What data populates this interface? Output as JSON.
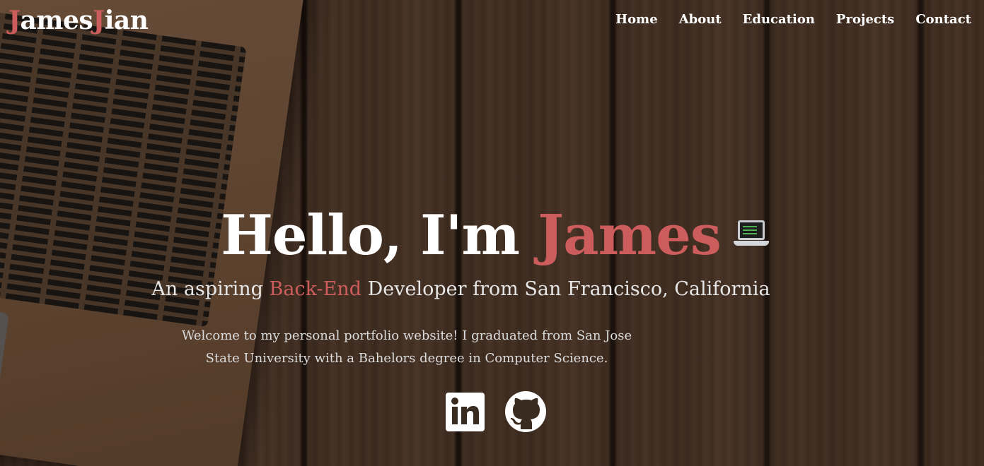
{
  "brand": {
    "first_initial": "J",
    "first_rest": "ames",
    "last_initial": "J",
    "last_rest": "ian",
    "accent_color": "#cd5c5c"
  },
  "nav": {
    "items": [
      {
        "label": "Home"
      },
      {
        "label": "About"
      },
      {
        "label": "Education"
      },
      {
        "label": "Projects"
      },
      {
        "label": "Contact"
      }
    ]
  },
  "hero": {
    "greeting": "Hello, I'm ",
    "name": "James",
    "emoji_icon": "laptop-icon",
    "subtitle_before": "An aspiring ",
    "subtitle_highlight": "Back-End",
    "subtitle_after": " Developer from San Francisco, California",
    "intro": "Welcome to my personal portfolio website! I graduated from San Jose State University with a Bahelors degree in Computer Science."
  },
  "socials": [
    {
      "icon": "linkedin-icon"
    },
    {
      "icon": "github-icon"
    }
  ]
}
